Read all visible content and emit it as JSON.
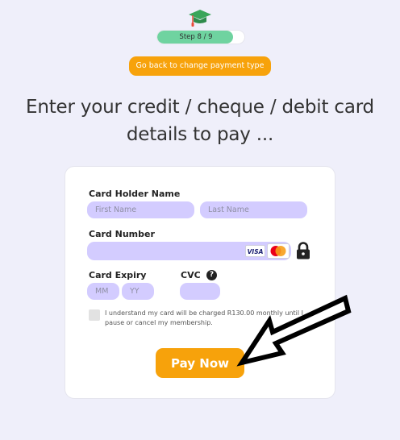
{
  "header": {
    "step_label": "Step 8 / 9",
    "progress": 0.87,
    "back_button_label": "Go back to change payment type",
    "heading_line1": "Enter your credit / cheque / debit card",
    "heading_line2": "details to pay ..."
  },
  "form": {
    "card_holder_label": "Card Holder Name",
    "first_name_placeholder": "First Name",
    "last_name_placeholder": "Last Name",
    "card_number_label": "Card Number",
    "card_number_value": "",
    "visa_text": "VISA",
    "expiry_label": "Card Expiry",
    "mm_placeholder": "MM",
    "yy_placeholder": "YY",
    "cvc_label": "CVC",
    "cvc_help": "?",
    "terms_text": "I understand my card will be charged R130.00 monthly until I pause or cancel my membership.",
    "pay_button_label": "Pay Now"
  },
  "colors": {
    "accent": "#f7a20b",
    "field_bg": "#d3ccff",
    "progress_fill": "#6fd3a0",
    "page_bg": "#efeffa"
  }
}
